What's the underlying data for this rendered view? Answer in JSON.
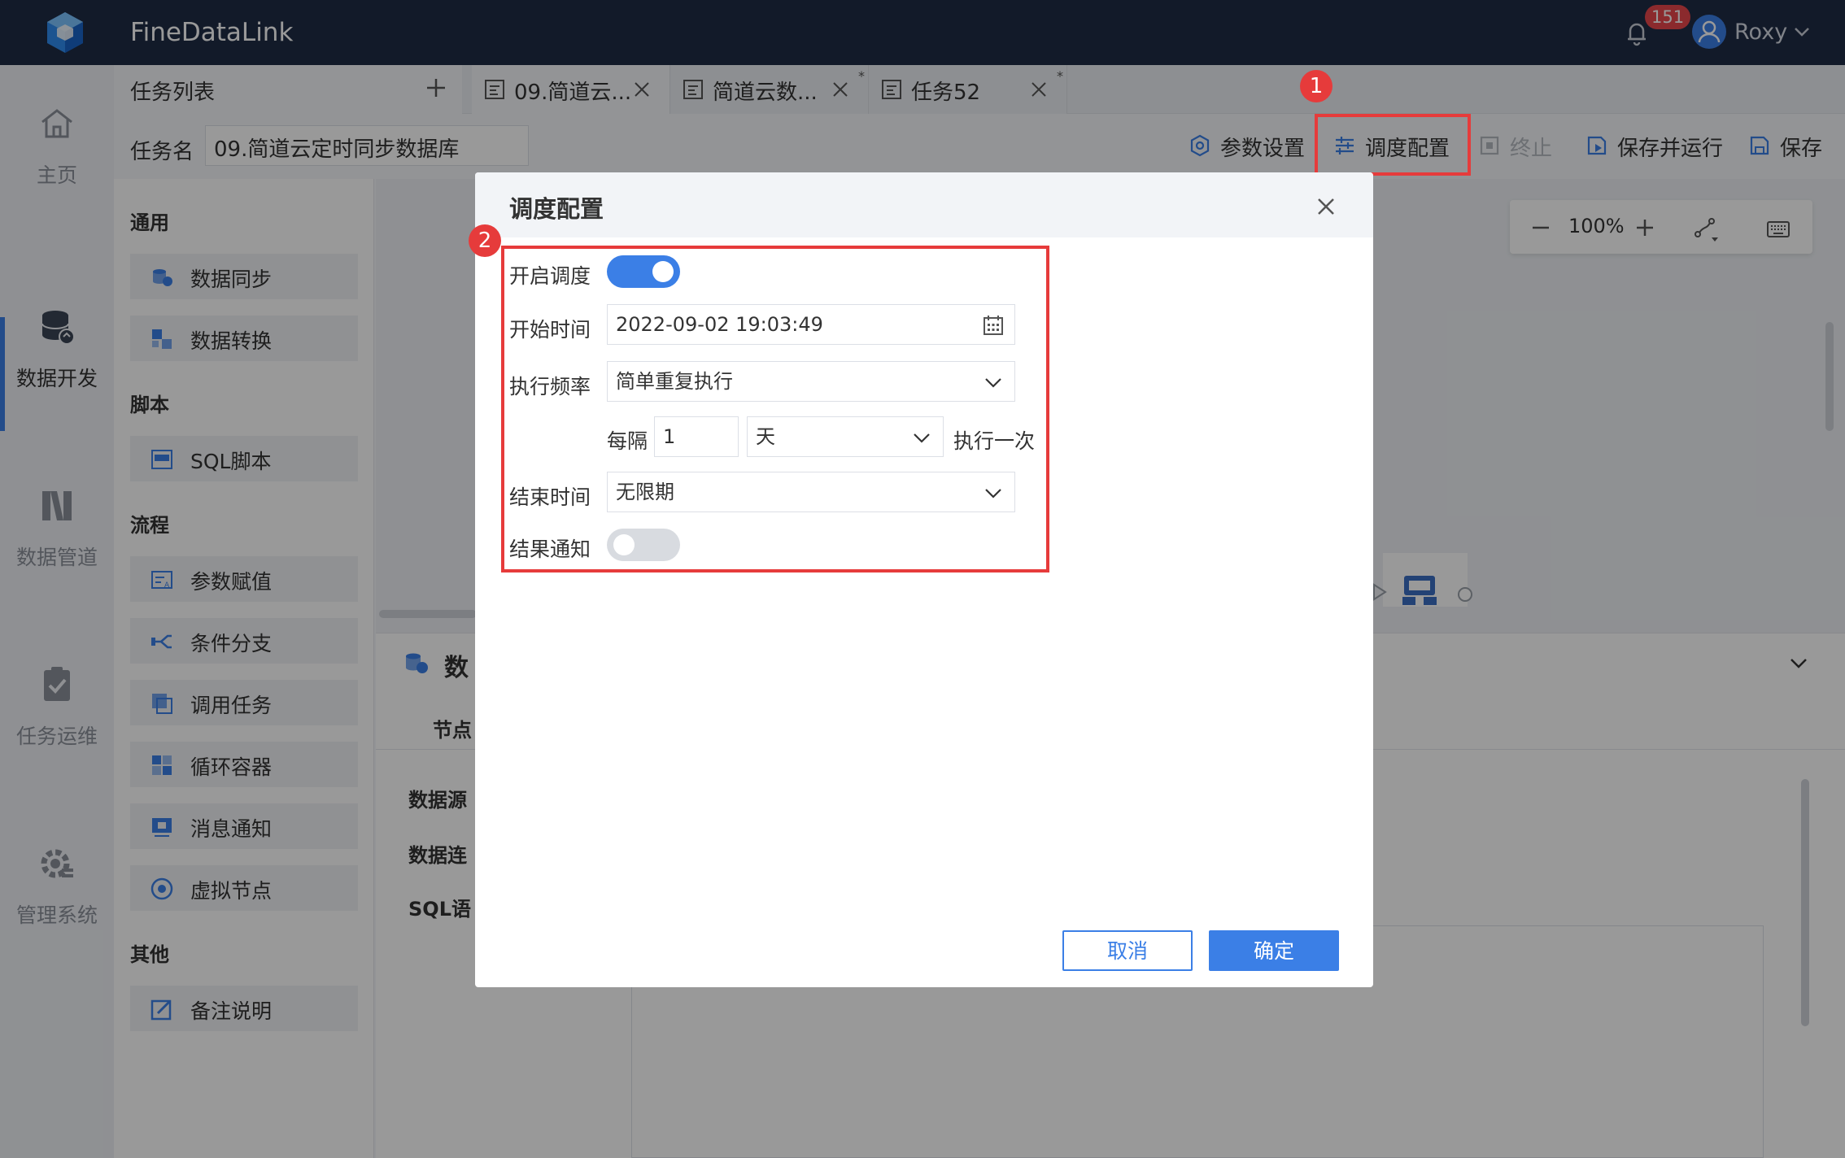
{
  "app": {
    "title": "FineDataLink",
    "notification_count": "151",
    "user_name": "Roxy"
  },
  "nav": [
    {
      "label": "主页",
      "icon": "home-icon"
    },
    {
      "label": "数据开发",
      "icon": "database-icon"
    },
    {
      "label": "数据管道",
      "icon": "pipeline-icon"
    },
    {
      "label": "任务运维",
      "icon": "clipboard-check-icon"
    },
    {
      "label": "管理系统",
      "icon": "gear-icon"
    }
  ],
  "tabs": {
    "tasklist_label": "任务列表",
    "docs": [
      {
        "label": "09.简道云...",
        "modified": ""
      },
      {
        "label": "简道云数...",
        "modified": "*"
      },
      {
        "label": "任务52",
        "modified": "*"
      }
    ]
  },
  "toolbar": {
    "taskname_label": "任务名",
    "taskname_value": "09.简道云定时同步数据库",
    "params_label": "参数设置",
    "schedule_label": "调度配置",
    "stop_label": "终止",
    "save_run_label": "保存并运行",
    "save_label": "保存"
  },
  "markers": {
    "one": "1",
    "two": "2"
  },
  "components": {
    "sections": [
      "通用",
      "脚本",
      "流程",
      "其他"
    ],
    "general": [
      "数据同步",
      "数据转换"
    ],
    "script": [
      "SQL脚本"
    ],
    "flow": [
      "参数赋值",
      "条件分支",
      "调用任务",
      "循环容器",
      "消息通知",
      "虚拟节点"
    ],
    "other": [
      "备注说明"
    ]
  },
  "canvas": {
    "zoom": "100%"
  },
  "bottom_panel": {
    "title_fragment": "数",
    "tab_fragment": "节点",
    "row_labels": [
      "数据源",
      "数据连",
      "SQL语"
    ]
  },
  "modal": {
    "title": "调度配置",
    "enable_label": "开启调度",
    "enable_on": true,
    "start_label": "开始时间",
    "start_value": "2022-09-02 19:03:49",
    "freq_label": "执行频率",
    "freq_value": "简单重复执行",
    "interval_prefix": "每隔",
    "interval_value": "1",
    "interval_unit": "天",
    "interval_suffix": "执行一次",
    "end_label": "结束时间",
    "end_value": "无限期",
    "notify_label": "结果通知",
    "notify_on": false,
    "cancel_label": "取消",
    "ok_label": "确定"
  },
  "colors": {
    "accent": "#3b7fe6",
    "highlight": "#e63b3b",
    "topbar": "#1e2c45"
  }
}
